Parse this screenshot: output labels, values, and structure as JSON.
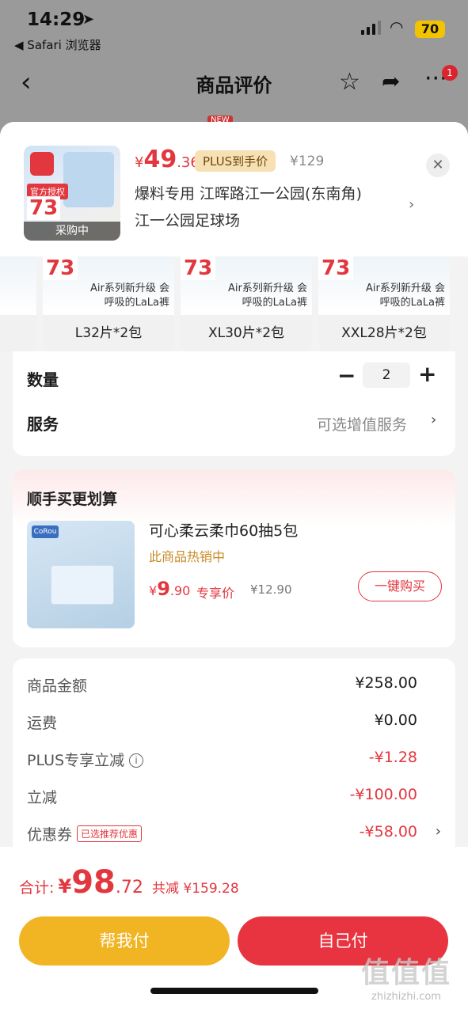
{
  "status": {
    "time": "14:29",
    "back_app": "◀ Safari 浏览器",
    "battery": "70"
  },
  "nav": {
    "title": "商品评价",
    "badge": "1",
    "new_tag": "NEW"
  },
  "product": {
    "price_symbol": "¥",
    "price_int": "49",
    "price_dec": ".36",
    "plus_label": "PLUS到手价",
    "orig_price": "¥129",
    "address_line1": "爆料专用  江晖路江一公园(东南角)",
    "address_line2": "江一公园足球场",
    "thumb_badge": "官方授权",
    "thumb_price": "73",
    "thumb_overlay": "采购中"
  },
  "skus": [
    {
      "name": "L32片*2包",
      "price": "73",
      "ad": "Air系列新升级 会呼吸的LaLa裤"
    },
    {
      "name": "XL30片*2包",
      "price": "73",
      "ad": "Air系列新升级 会呼吸的LaLa裤"
    },
    {
      "name": "XXL28片*2包",
      "price": "73",
      "ad": "Air系列新升级 会呼吸的LaLa裤"
    }
  ],
  "quantity": {
    "label": "数量",
    "value": "2",
    "minus": "−",
    "plus": "+"
  },
  "service": {
    "label": "服务",
    "value": "可选增值服务"
  },
  "upsell": {
    "title": "顺手买更划算",
    "brand": "CoRou",
    "name": "可心柔云柔巾60抽5包",
    "hot": "此商品热销中",
    "price_symbol": "¥",
    "price_int": "9",
    "price_dec": ".90",
    "exclusive": "专享价",
    "orig_price": "¥12.90",
    "button": "一键购买"
  },
  "summary": [
    {
      "label": "商品金额",
      "value": "¥258.00",
      "red": false
    },
    {
      "label": "运费",
      "value": "¥0.00",
      "red": false
    },
    {
      "label": "PLUS专享立减",
      "value": "-¥1.28",
      "red": true
    },
    {
      "label": "立减",
      "value": "-¥100.00",
      "red": true
    },
    {
      "label": "优惠券",
      "value": "-¥58.00",
      "red": true,
      "tag": "已选推荐优惠"
    }
  ],
  "total": {
    "label": "合计:",
    "symbol": "¥",
    "int": "98",
    "dec": ".72",
    "saving": "共减 ¥159.28"
  },
  "buttons": {
    "help": "帮我付",
    "self": "自己付"
  },
  "watermark": {
    "big": "值值值",
    "small": "zhizhizhi.com"
  },
  "colors": {
    "accent": "#e2373e",
    "help_button": "#f1b423",
    "self_button": "#e83440"
  }
}
